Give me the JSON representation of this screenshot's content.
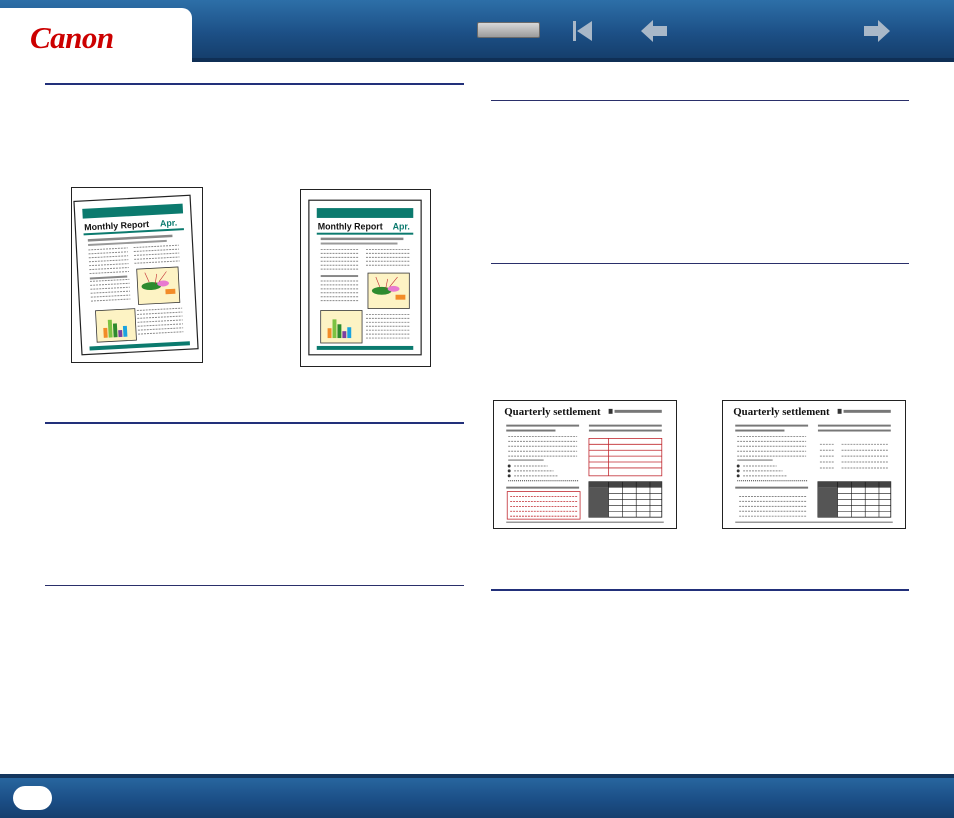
{
  "header": {
    "logo_text": "Canon",
    "nav_icons": [
      "first-page-icon",
      "previous-page-icon",
      "next-page-icon"
    ]
  },
  "figures": {
    "skewed_doc_title": "Monthly Report",
    "skewed_doc_month": "Apr.",
    "deskewed_doc_title": "Monthly Report",
    "deskewed_doc_month": "Apr.",
    "settlement_before_title": "Quarterly settlement",
    "settlement_after_title": "Quarterly settlement"
  },
  "footer": {
    "page_number": ""
  },
  "colors": {
    "header_blue": "#1c4f85",
    "logo_red": "#cc0000",
    "rule_navy": "#22307a",
    "teal_bar": "#0b7a6e",
    "dropout_red": "#c0282f"
  }
}
